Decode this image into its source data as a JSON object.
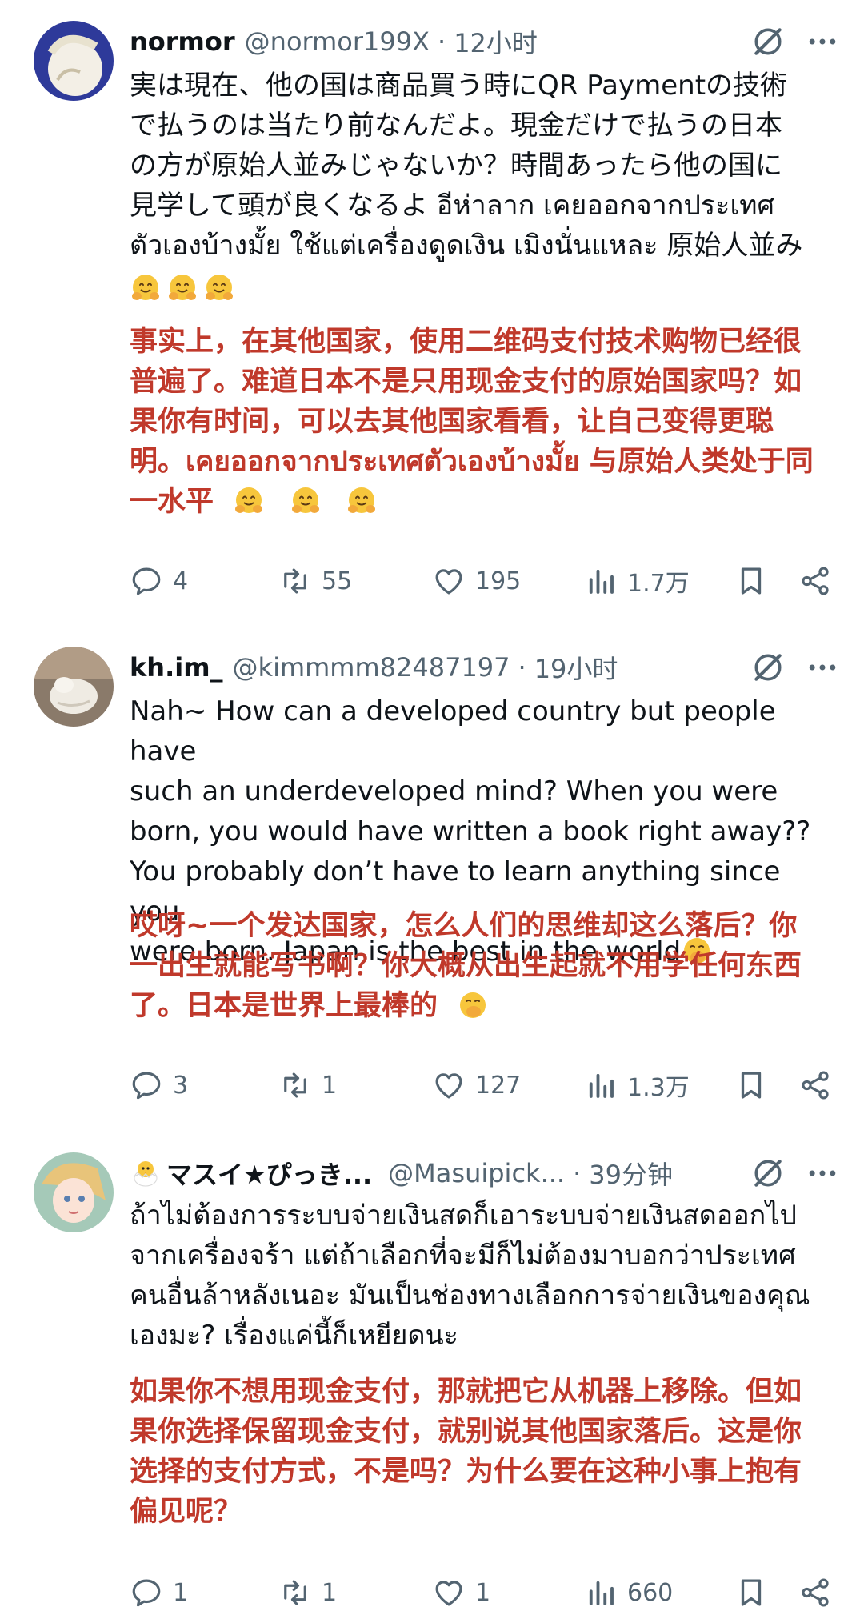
{
  "tweets": [
    {
      "name": "normor",
      "handle": "@normor199X",
      "time": "12小时",
      "lines": [
        "実は現在、他の国は商品買う時にQR Paymentの技術",
        "で払うのは当たり前なんだよ。現金だけで払うの日本",
        "の方が原始人並みじゃないか？時間あったら他の国に",
        "見学して頭が良くなるよ อีห่าลาก เคยออกจากประเทศ",
        "ตัวเองบ้างมั้ย ใช้แต่เครื่องดูดเงิน เมิงนั่นแหละ 原始人並み"
      ],
      "translation": [
        "事实上，在其他国家，使用二维码支付技术购物已经很",
        "普遍了。难道日本不是只用现金支付的原始国家吗？如",
        "果你有时间，可以去其他国家看看，让自己变得更聪",
        "明。เคยออกจากประเทศตัวเองบ้างมั้ย 与原始人类处于同",
        "一水平"
      ],
      "replies": "4",
      "reposts": "55",
      "likes": "195",
      "views": "1.7万"
    },
    {
      "name": "kh.im_",
      "handle": "@kimmmm82487197",
      "time": "19小时",
      "lines": [
        "Nah~ How can a developed country but people have",
        "such an underdeveloped mind? When you were",
        "born, you would have written a book right away??",
        "You probably don’t have to learn anything since you",
        "were born. Japan is the best in the world"
      ],
      "translation": [
        "哎呀~一个发达国家，怎么人们的思维却这么落后？你",
        "一出生就能写书啊？你大概从出生起就不用学任何东西",
        "了。日本是世界上最棒的"
      ],
      "replies": "3",
      "reposts": "1",
      "likes": "127",
      "views": "1.3万"
    },
    {
      "name": "マスイ★ぴっき...",
      "handle": "@Masuipick...",
      "time": "39分钟",
      "lines": [
        "ถ้าไม่ต้องการระบบจ่ายเงินสดก็เอาระบบจ่ายเงินสดออกไป",
        "จากเครื่องจร้า แต่ถ้าเลือกที่จะมีก็ไม่ต้องมาบอกว่าประเทศ",
        "คนอื่นล้าหลังเนอะ มันเป็นช่องทางเลือกการจ่ายเงินของคุณ",
        "เองมะ? เรื่องแค่นี้ก็เหยียดนะ"
      ],
      "translation": [
        "如果你不想用现金支付，那就把它从机器上移除。但如",
        "果你选择保留现金支付，就别说其他国家落后。这是你",
        "选择的支付方式，不是吗？为什么要在这种小事上抱有",
        "偏见呢？"
      ],
      "replies": "1",
      "reposts": "1",
      "likes": "1",
      "views": "660"
    }
  ],
  "colors": {
    "translation": "#c0392b",
    "secondary": "#536471"
  },
  "icons": [
    "reply-icon",
    "repost-icon",
    "like-icon",
    "views-icon",
    "bookmark-icon",
    "share-icon",
    "grok-icon",
    "more-icon",
    "hugging-face-emoji",
    "face-with-hand-over-mouth-emoji",
    "hatching-chick-emoji"
  ]
}
